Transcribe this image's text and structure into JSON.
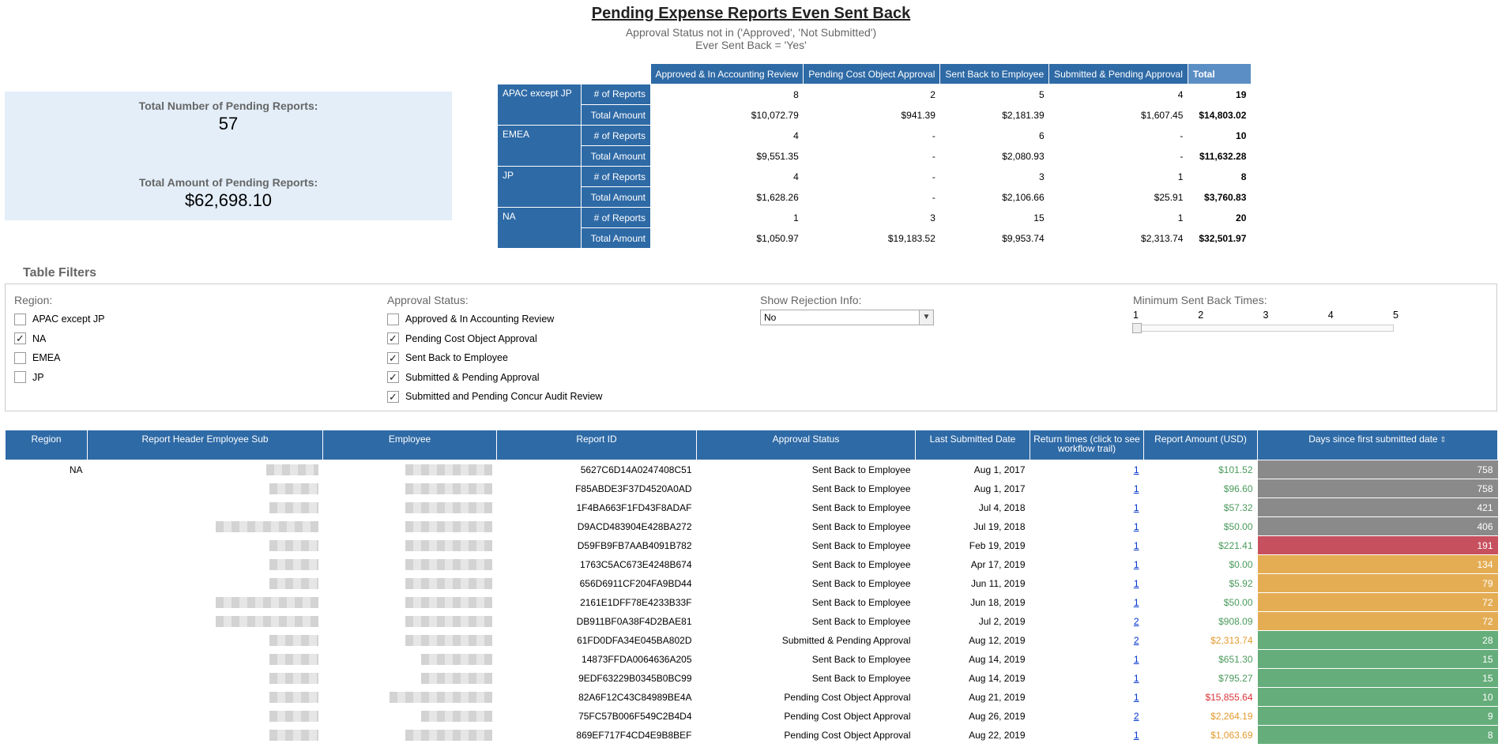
{
  "header": {
    "title": "Pending Expense Reports Even Sent Back",
    "subtitle1": "Approval Status not in ('Approved', 'Not Submitted')",
    "subtitle2": "Ever Sent Back = 'Yes'"
  },
  "kpi": {
    "count_label": "Total Number of Pending Reports:",
    "count_value": "57",
    "amount_label": "Total Amount of Pending Reports:",
    "amount_value": "$62,698.10"
  },
  "summary": {
    "columns": [
      "Approved & In Accounting Review",
      "Pending Cost Object Approval",
      "Sent Back to Employee",
      "Submitted & Pending Approval",
      "Total"
    ],
    "metric_labels": [
      "# of Reports",
      "Total Amount"
    ],
    "regions": [
      {
        "name": "APAC except JP",
        "reports": [
          "8",
          "2",
          "5",
          "4",
          "19"
        ],
        "amounts": [
          "$10,072.79",
          "$941.39",
          "$2,181.39",
          "$1,607.45",
          "$14,803.02"
        ]
      },
      {
        "name": "EMEA",
        "reports": [
          "4",
          "-",
          "6",
          "-",
          "10"
        ],
        "amounts": [
          "$9,551.35",
          "-",
          "$2,080.93",
          "-",
          "$11,632.28"
        ]
      },
      {
        "name": "JP",
        "reports": [
          "4",
          "-",
          "3",
          "1",
          "8"
        ],
        "amounts": [
          "$1,628.26",
          "-",
          "$2,106.66",
          "$25.91",
          "$3,760.83"
        ]
      },
      {
        "name": "NA",
        "reports": [
          "1",
          "3",
          "15",
          "1",
          "20"
        ],
        "amounts": [
          "$1,050.97",
          "$19,183.52",
          "$9,953.74",
          "$2,313.74",
          "$32,501.97"
        ]
      }
    ]
  },
  "filters": {
    "title": "Table Filters",
    "region_label": "Region:",
    "regions": [
      {
        "label": "APAC except JP",
        "checked": false
      },
      {
        "label": "NA",
        "checked": true
      },
      {
        "label": "EMEA",
        "checked": false
      },
      {
        "label": "JP",
        "checked": false
      }
    ],
    "status_label": "Approval Status:",
    "statuses": [
      {
        "label": "Approved & In Accounting Review",
        "checked": false
      },
      {
        "label": "Pending Cost Object Approval",
        "checked": true
      },
      {
        "label": "Sent Back to Employee",
        "checked": true
      },
      {
        "label": "Submitted & Pending Approval",
        "checked": true
      },
      {
        "label": "Submitted and Pending Concur Audit Review",
        "checked": true
      }
    ],
    "rejection_label": "Show Rejection Info:",
    "rejection_value": "No",
    "sentback_label": "Minimum Sent Back Times:",
    "sentback_ticks": [
      "1",
      "2",
      "3",
      "4",
      "5"
    ],
    "sentback_value": 1
  },
  "detail": {
    "columns": [
      "Region",
      "Report Header Employee Sub",
      "Employee",
      "Report ID",
      "Approval Status",
      "Last Submitted Date",
      "Return times (click to see workflow trail)",
      "Report Amount (USD)",
      "Days since first submitted date"
    ],
    "colors": {
      "gray": "#8a8a8a",
      "red": "#c7505f",
      "orange": "#e4ad54",
      "green": "#65ad7a",
      "amt_green": "#4a9a5c",
      "amt_orange": "#e39a2e",
      "amt_red": "#d9343a"
    },
    "rows": [
      {
        "region": "NA",
        "id": "5627C6D14A0247408C51",
        "status": "Sent Back to Employee",
        "date": "Aug 1, 2017",
        "returns": "1",
        "amount": "$101.52",
        "amt_color": "amt_green",
        "days": "758",
        "days_color": "gray"
      },
      {
        "region": "",
        "id": "F85ABDE3F37D4520A0AD",
        "status": "Sent Back to Employee",
        "date": "Aug 1, 2017",
        "returns": "1",
        "amount": "$96.60",
        "amt_color": "amt_green",
        "days": "758",
        "days_color": "gray"
      },
      {
        "region": "",
        "id": "1F4BA663F1FD43F8ADAF",
        "status": "Sent Back to Employee",
        "date": "Jul 4, 2018",
        "returns": "1",
        "amount": "$57.32",
        "amt_color": "amt_green",
        "days": "421",
        "days_color": "gray"
      },
      {
        "region": "",
        "id": "D9ACD483904E428BA272",
        "status": "Sent Back to Employee",
        "date": "Jul 19, 2018",
        "returns": "1",
        "amount": "$50.00",
        "amt_color": "amt_green",
        "days": "406",
        "days_color": "gray"
      },
      {
        "region": "",
        "id": "D59FB9FB7AAB4091B782",
        "status": "Sent Back to Employee",
        "date": "Feb 19, 2019",
        "returns": "1",
        "amount": "$221.41",
        "amt_color": "amt_green",
        "days": "191",
        "days_color": "red"
      },
      {
        "region": "",
        "id": "1763C5AC673E4248B674",
        "status": "Sent Back to Employee",
        "date": "Apr 17, 2019",
        "returns": "1",
        "amount": "$0.00",
        "amt_color": "amt_green",
        "days": "134",
        "days_color": "orange"
      },
      {
        "region": "",
        "id": "656D6911CF204FA9BD44",
        "status": "Sent Back to Employee",
        "date": "Jun 11, 2019",
        "returns": "1",
        "amount": "$5.92",
        "amt_color": "amt_green",
        "days": "79",
        "days_color": "orange"
      },
      {
        "region": "",
        "id": "2161E1DFF78E4233B33F",
        "status": "Sent Back to Employee",
        "date": "Jun 18, 2019",
        "returns": "1",
        "amount": "$50.00",
        "amt_color": "amt_green",
        "days": "72",
        "days_color": "orange"
      },
      {
        "region": "",
        "id": "DB911BF0A38F4D2BAE81",
        "status": "Sent Back to Employee",
        "date": "Jul 2, 2019",
        "returns": "2",
        "amount": "$908.09",
        "amt_color": "amt_green",
        "days": "72",
        "days_color": "orange"
      },
      {
        "region": "",
        "id": "61FD0DFA34E045BA802D",
        "status": "Submitted & Pending Approval",
        "date": "Aug 12, 2019",
        "returns": "2",
        "amount": "$2,313.74",
        "amt_color": "amt_orange",
        "days": "28",
        "days_color": "green"
      },
      {
        "region": "",
        "id": "14873FFDA0064636A205",
        "status": "Sent Back to Employee",
        "date": "Aug 14, 2019",
        "returns": "1",
        "amount": "$651.30",
        "amt_color": "amt_green",
        "days": "15",
        "days_color": "green"
      },
      {
        "region": "",
        "id": "9EDF63229B0345B0BC99",
        "status": "Sent Back to Employee",
        "date": "Aug 14, 2019",
        "returns": "1",
        "amount": "$795.27",
        "amt_color": "amt_green",
        "days": "15",
        "days_color": "green"
      },
      {
        "region": "",
        "id": "82A6F12C43C84989BE4A",
        "status": "Pending Cost Object Approval",
        "date": "Aug 21, 2019",
        "returns": "1",
        "amount": "$15,855.64",
        "amt_color": "amt_red",
        "days": "10",
        "days_color": "green"
      },
      {
        "region": "",
        "id": "75FC57B006F549C2B4D4",
        "status": "Pending Cost Object Approval",
        "date": "Aug 26, 2019",
        "returns": "2",
        "amount": "$2,264.19",
        "amt_color": "amt_orange",
        "days": "9",
        "days_color": "green"
      },
      {
        "region": "",
        "id": "869EF717F4CD4E9B8BEF",
        "status": "Pending Cost Object Approval",
        "date": "Aug 22, 2019",
        "returns": "1",
        "amount": "$1,063.69",
        "amt_color": "amt_orange",
        "days": "8",
        "days_color": "green"
      }
    ]
  }
}
